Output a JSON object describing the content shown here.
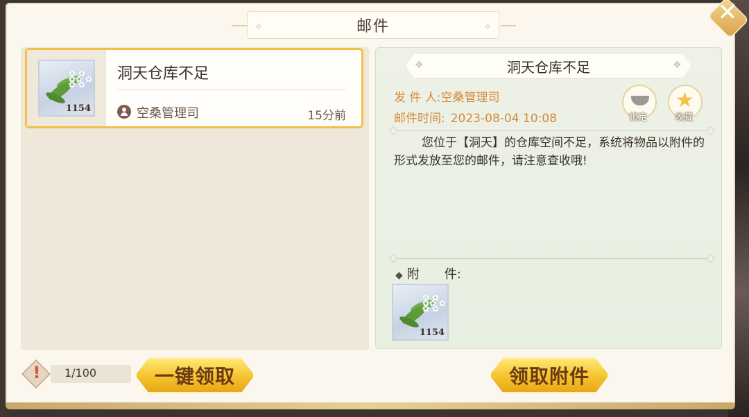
{
  "header": {
    "title": "邮件"
  },
  "mail_list": {
    "items": [
      {
        "title": "洞天仓库不足",
        "sender": "空桑管理司",
        "time": "15分前",
        "item_count": "1154"
      }
    ]
  },
  "detail": {
    "title": "洞天仓库不足",
    "sender_label": "发 件 人:",
    "sender_value": "空桑管理司",
    "time_label": "邮件时间:",
    "time_value": "2023-08-04 10:08",
    "lock_label": "锁定",
    "favorite_label": "收藏",
    "body": "您位于【洞天】的仓库空间不足，系统将物品以附件的形式发放至您的邮件，请注意查收哦!",
    "attachment_label": "附　　件:",
    "attachment_count": "1154"
  },
  "footer": {
    "mail_count": "1/100",
    "claim_all_label": "一键领取",
    "claim_attachment_label": "领取附件"
  },
  "colors": {
    "accent_gold": "#f4c22c",
    "meta_orange": "#d48a3b",
    "card_border": "#f2c04a"
  }
}
